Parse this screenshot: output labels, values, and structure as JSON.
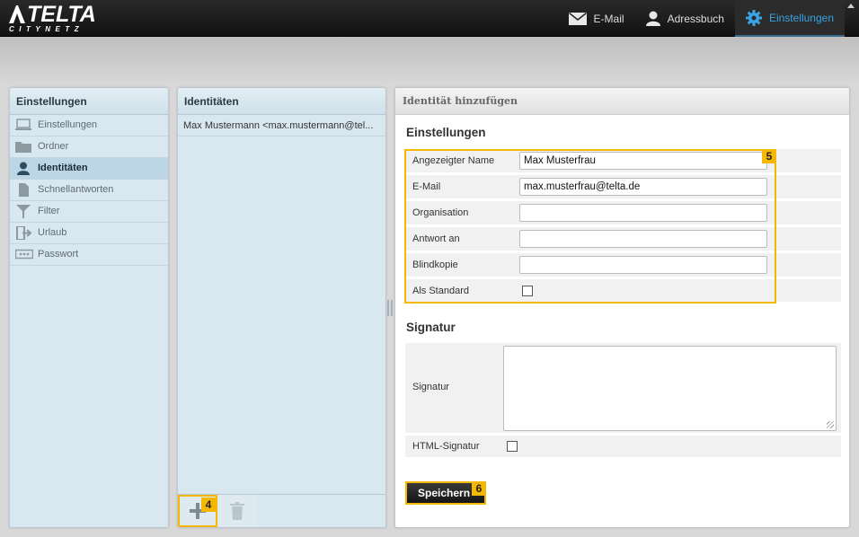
{
  "header": {
    "logo_text": "TELTA",
    "logo_subtext": "CITYNETZ",
    "nav": [
      {
        "label": "E-Mail",
        "icon": "envelope-icon"
      },
      {
        "label": "Adressbuch",
        "icon": "person-icon"
      },
      {
        "label": "Einstellungen",
        "icon": "gear-icon",
        "active": true
      }
    ],
    "accent_color": "#3aa3e3"
  },
  "settings_panel": {
    "title": "Einstellungen",
    "items": [
      {
        "label": "Einstellungen",
        "icon": "monitor-icon"
      },
      {
        "label": "Ordner",
        "icon": "folder-icon"
      },
      {
        "label": "Identitäten",
        "icon": "person-icon",
        "selected": true
      },
      {
        "label": "Schnellantworten",
        "icon": "document-icon"
      },
      {
        "label": "Filter",
        "icon": "funnel-icon"
      },
      {
        "label": "Urlaub",
        "icon": "exit-icon"
      },
      {
        "label": "Passwort",
        "icon": "password-icon"
      }
    ]
  },
  "identities_panel": {
    "title": "Identitäten",
    "items": [
      "Max Mustermann <max.mustermann@tel..."
    ],
    "add_badge": "4"
  },
  "form_panel": {
    "title": "Identität hinzufügen",
    "settings_section": "Einstellungen",
    "settings_badge": "5",
    "fields": {
      "display_name": {
        "label": "Angezeigter Name",
        "value": "Max Musterfrau"
      },
      "email": {
        "label": "E-Mail",
        "value": "max.musterfrau@telta.de"
      },
      "organisation": {
        "label": "Organisation",
        "value": ""
      },
      "reply_to": {
        "label": "Antwort an",
        "value": ""
      },
      "bcc": {
        "label": "Blindkopie",
        "value": ""
      },
      "default": {
        "label": "Als Standard",
        "checked": false
      }
    },
    "signature_section": "Signatur",
    "signature_label": "Signatur",
    "signature_value": "",
    "html_signature_label": "HTML-Signatur",
    "save_label": "Speichern",
    "save_badge": "6"
  },
  "colors": {
    "highlight": "#f5b800",
    "panel_bg": "#d9e8f0"
  }
}
